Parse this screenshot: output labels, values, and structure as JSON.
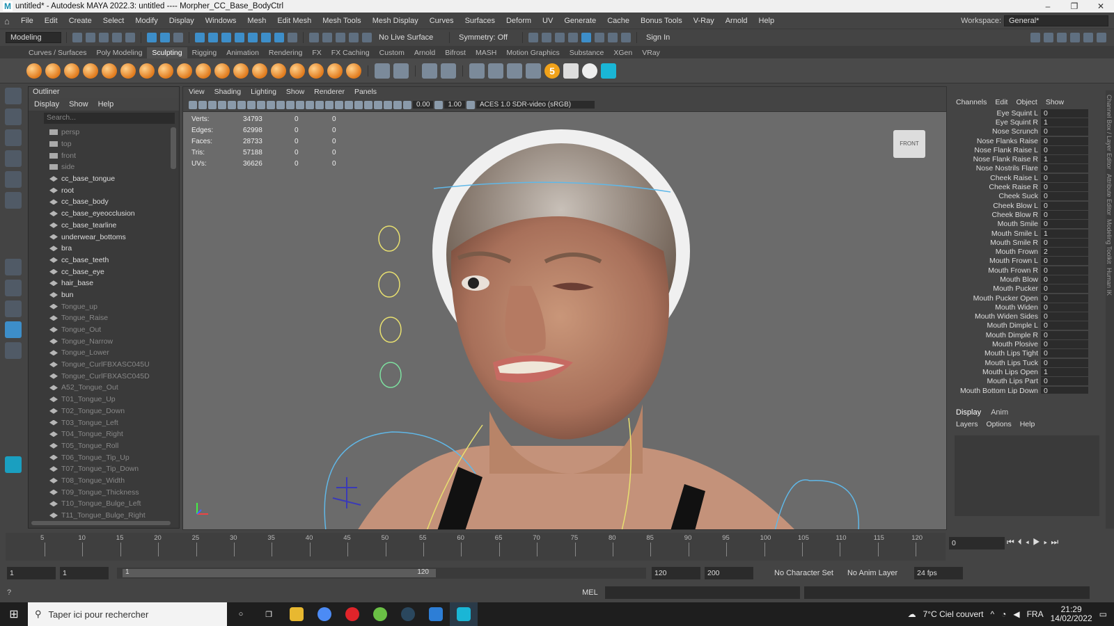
{
  "window": {
    "title": "untitled* - Autodesk MAYA 2022.3: untitled   ----   Morpher_CC_Base_BodyCtrl"
  },
  "menubar": {
    "items": [
      "File",
      "Edit",
      "Create",
      "Select",
      "Modify",
      "Display",
      "Windows",
      "Mesh",
      "Edit Mesh",
      "Mesh Tools",
      "Mesh Display",
      "Curves",
      "Surfaces",
      "Deform",
      "UV",
      "Generate",
      "Cache",
      "Bonus Tools",
      "V-Ray",
      "Arnold",
      "Help"
    ],
    "workspace_label": "Workspace:",
    "workspace_value": "General*"
  },
  "statusline": {
    "mode": "Modeling",
    "live_surface": "No Live Surface",
    "symmetry": "Symmetry: Off",
    "sign_in": "Sign In"
  },
  "shelf": {
    "tabs": [
      "Curves / Surfaces",
      "Poly Modeling",
      "Sculpting",
      "Rigging",
      "Animation",
      "Rendering",
      "FX",
      "FX Caching",
      "Custom",
      "Arnold",
      "Bifrost",
      "MASH",
      "Motion Graphics",
      "Substance",
      "XGen",
      "VRay"
    ],
    "active_tab": "Sculpting",
    "five_label": "5"
  },
  "outliner": {
    "title": "Outliner",
    "menu": [
      "Display",
      "Show",
      "Help"
    ],
    "search_placeholder": "Search...",
    "items": [
      {
        "label": "persp",
        "type": "cam",
        "dim": true
      },
      {
        "label": "top",
        "type": "cam",
        "dim": true
      },
      {
        "label": "front",
        "type": "cam",
        "dim": true
      },
      {
        "label": "side",
        "type": "cam",
        "dim": true
      },
      {
        "label": "cc_base_tongue",
        "type": "joint",
        "dim": false
      },
      {
        "label": "root",
        "type": "joint",
        "dim": false
      },
      {
        "label": "cc_base_body",
        "type": "joint",
        "dim": false
      },
      {
        "label": "cc_base_eyeocclusion",
        "type": "joint",
        "dim": false
      },
      {
        "label": "cc_base_tearline",
        "type": "joint",
        "dim": false
      },
      {
        "label": "underwear_bottoms",
        "type": "joint",
        "dim": false
      },
      {
        "label": "bra",
        "type": "joint",
        "dim": false
      },
      {
        "label": "cc_base_teeth",
        "type": "joint",
        "dim": false
      },
      {
        "label": "cc_base_eye",
        "type": "joint",
        "dim": false
      },
      {
        "label": "hair_base",
        "type": "joint",
        "dim": false
      },
      {
        "label": "bun",
        "type": "joint",
        "dim": false
      },
      {
        "label": "Tongue_up",
        "type": "joint",
        "dim": true
      },
      {
        "label": "Tongue_Raise",
        "type": "joint",
        "dim": true
      },
      {
        "label": "Tongue_Out",
        "type": "joint",
        "dim": true
      },
      {
        "label": "Tongue_Narrow",
        "type": "joint",
        "dim": true
      },
      {
        "label": "Tongue_Lower",
        "type": "joint",
        "dim": true
      },
      {
        "label": "Tongue_CurlFBXASC045U",
        "type": "joint",
        "dim": true
      },
      {
        "label": "Tongue_CurlFBXASC045D",
        "type": "joint",
        "dim": true
      },
      {
        "label": "A52_Tongue_Out",
        "type": "joint",
        "dim": true
      },
      {
        "label": "T01_Tongue_Up",
        "type": "joint",
        "dim": true
      },
      {
        "label": "T02_Tongue_Down",
        "type": "joint",
        "dim": true
      },
      {
        "label": "T03_Tongue_Left",
        "type": "joint",
        "dim": true
      },
      {
        "label": "T04_Tongue_Right",
        "type": "joint",
        "dim": true
      },
      {
        "label": "T05_Tongue_Roll",
        "type": "joint",
        "dim": true
      },
      {
        "label": "T06_Tongue_Tip_Up",
        "type": "joint",
        "dim": true
      },
      {
        "label": "T07_Tongue_Tip_Down",
        "type": "joint",
        "dim": true
      },
      {
        "label": "T08_Tongue_Width",
        "type": "joint",
        "dim": true
      },
      {
        "label": "T09_Tongue_Thickness",
        "type": "joint",
        "dim": true
      },
      {
        "label": "T10_Tongue_Bulge_Left",
        "type": "joint",
        "dim": true
      },
      {
        "label": "T11_Tongue_Bulge_Right",
        "type": "joint",
        "dim": true
      }
    ]
  },
  "viewport": {
    "menu": [
      "View",
      "Shading",
      "Lighting",
      "Show",
      "Renderer",
      "Panels"
    ],
    "exposure": "0.00",
    "gamma": "1.00",
    "color_space": "ACES 1.0 SDR-video (sRGB)",
    "hud": [
      {
        "label": "Verts:",
        "a": "34793",
        "b": "0",
        "c": "0"
      },
      {
        "label": "Edges:",
        "a": "62998",
        "b": "0",
        "c": "0"
      },
      {
        "label": "Faces:",
        "a": "28733",
        "b": "0",
        "c": "0"
      },
      {
        "label": "Tris:",
        "a": "57188",
        "b": "0",
        "c": "0"
      },
      {
        "label": "UVs:",
        "a": "36626",
        "b": "0",
        "c": "0"
      }
    ],
    "view_cube": "FRONT"
  },
  "channel_box": {
    "menu": [
      "Channels",
      "Edit",
      "Object",
      "Show"
    ],
    "rows": [
      {
        "name": "Eye Squint L",
        "value": "0"
      },
      {
        "name": "Eye Squint R",
        "value": "1"
      },
      {
        "name": "Nose Scrunch",
        "value": "0"
      },
      {
        "name": "Nose Flanks Raise",
        "value": "0"
      },
      {
        "name": "Nose Flank Raise L",
        "value": "0"
      },
      {
        "name": "Nose Flank Raise R",
        "value": "1"
      },
      {
        "name": "Nose Nostrils Flare",
        "value": "0"
      },
      {
        "name": "Cheek Raise L",
        "value": "0"
      },
      {
        "name": "Cheek Raise R",
        "value": "0"
      },
      {
        "name": "Cheek Suck",
        "value": "0"
      },
      {
        "name": "Cheek Blow L",
        "value": "0"
      },
      {
        "name": "Cheek Blow R",
        "value": "0"
      },
      {
        "name": "Mouth Smile",
        "value": "0"
      },
      {
        "name": "Mouth Smile L",
        "value": "1"
      },
      {
        "name": "Mouth Smile R",
        "value": "0"
      },
      {
        "name": "Mouth Frown",
        "value": "2"
      },
      {
        "name": "Mouth Frown L",
        "value": "0"
      },
      {
        "name": "Mouth Frown R",
        "value": "0"
      },
      {
        "name": "Mouth Blow",
        "value": "0"
      },
      {
        "name": "Mouth Pucker",
        "value": "0"
      },
      {
        "name": "Mouth Pucker Open",
        "value": "0"
      },
      {
        "name": "Mouth Widen",
        "value": "0"
      },
      {
        "name": "Mouth Widen Sides",
        "value": "0"
      },
      {
        "name": "Mouth Dimple L",
        "value": "0"
      },
      {
        "name": "Mouth Dimple R",
        "value": "0"
      },
      {
        "name": "Mouth Plosive",
        "value": "0"
      },
      {
        "name": "Mouth Lips Tight",
        "value": "0"
      },
      {
        "name": "Mouth Lips Tuck",
        "value": "0"
      },
      {
        "name": "Mouth Lips Open",
        "value": "1"
      },
      {
        "name": "Mouth Lips Part",
        "value": "0"
      },
      {
        "name": "Mouth Bottom Lip Down",
        "value": "0"
      }
    ]
  },
  "layers": {
    "tabs": [
      "Display",
      "Anim"
    ],
    "active_tab": "Display",
    "menu": [
      "Layers",
      "Options",
      "Help"
    ]
  },
  "side_strip": [
    "Channel Box / Layer Editor",
    "Attribute Editor",
    "Modeling Toolkit",
    "Human IK"
  ],
  "timeline": {
    "ticks": [
      "5",
      "10",
      "15",
      "20",
      "25",
      "30",
      "35",
      "40",
      "45",
      "50",
      "55",
      "60",
      "65",
      "70",
      "75",
      "80",
      "85",
      "90",
      "95",
      "100",
      "105",
      "110",
      "115",
      "120"
    ],
    "current_frame": "0"
  },
  "range": {
    "start": "1",
    "anim_start": "1",
    "slider_start": "1",
    "slider_end": "120",
    "end": "120",
    "anim_end": "200",
    "character_set": "No Character Set",
    "anim_layer": "No Anim Layer",
    "fps": "24 fps"
  },
  "cmdline": {
    "lang": "MEL"
  },
  "taskbar": {
    "search_placeholder": "Taper ici pour rechercher",
    "weather": "7°C  Ciel couvert",
    "lang": "FRA",
    "time": "21:29",
    "date": "14/02/2022"
  },
  "colors": {
    "accent": "#3d8ec9",
    "shelf_orange": "#e07a1c",
    "viewport_bg": "#6b6b6b"
  }
}
